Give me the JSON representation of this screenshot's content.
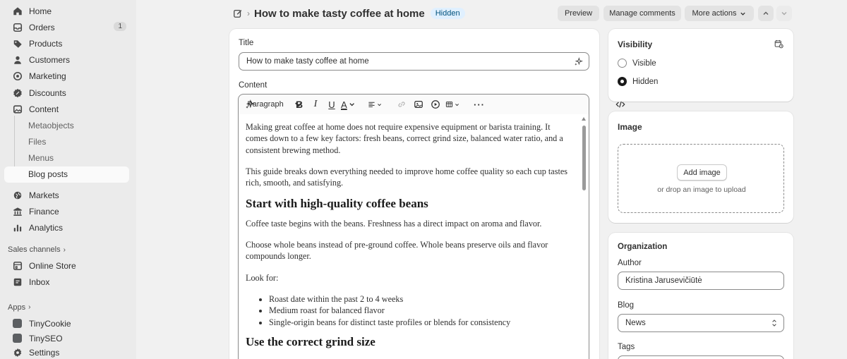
{
  "sidebar": {
    "main": [
      {
        "label": "Home",
        "icon": "home-icon"
      },
      {
        "label": "Orders",
        "icon": "inbox-icon",
        "badge": "1"
      },
      {
        "label": "Products",
        "icon": "tag-icon"
      },
      {
        "label": "Customers",
        "icon": "person-icon"
      },
      {
        "label": "Marketing",
        "icon": "target-icon"
      },
      {
        "label": "Discounts",
        "icon": "discount-icon"
      },
      {
        "label": "Content",
        "icon": "image-icon"
      }
    ],
    "content_sub": [
      "Metaobjects",
      "Files",
      "Menus",
      "Blog posts"
    ],
    "more": [
      {
        "label": "Markets",
        "icon": "globe-icon"
      },
      {
        "label": "Finance",
        "icon": "bank-icon"
      },
      {
        "label": "Analytics",
        "icon": "bar-chart-icon"
      }
    ],
    "sales_channels_label": "Sales channels",
    "sales_channels": [
      {
        "label": "Online Store",
        "icon": "store-icon"
      },
      {
        "label": "Inbox",
        "icon": "chat-icon"
      }
    ],
    "apps_label": "Apps",
    "apps": [
      {
        "label": "TinyCookie"
      },
      {
        "label": "TinySEO"
      }
    ],
    "settings_label": "Settings"
  },
  "header": {
    "title": "How to make tasty coffee at home",
    "status": "Hidden",
    "preview_label": "Preview",
    "manage_comments_label": "Manage comments",
    "more_actions_label": "More actions"
  },
  "editor": {
    "title_label": "Title",
    "title_value": "How to make tasty coffee at home",
    "content_label": "Content",
    "paragraph_style": "Paragraph",
    "body": {
      "p1": "Making great coffee at home does not require expensive equipment or barista training. It comes down to a few key factors: fresh beans, correct grind size, balanced water ratio, and a consistent brewing method.",
      "p2": "This guide breaks down everything needed to improve home coffee quality so each cup tastes rich, smooth, and satisfying.",
      "h1": "Start with high-quality coffee beans",
      "p3": "Coffee taste begins with the beans. Freshness has a direct impact on aroma and flavor.",
      "p4": "Choose whole beans instead of pre-ground coffee. Whole beans preserve oils and flavor compounds longer.",
      "p5": "Look for:",
      "list": [
        "Roast date within the past 2 to 4 weeks",
        "Medium roast for balanced flavor",
        "Single-origin beans for distinct taste profiles or blends for consistency"
      ],
      "h2": "Use the correct grind size"
    }
  },
  "visibility": {
    "title": "Visibility",
    "options": [
      "Visible",
      "Hidden"
    ],
    "selected": "Hidden"
  },
  "image_card": {
    "title": "Image",
    "add_label": "Add image",
    "hint": "or drop an image to upload"
  },
  "organization": {
    "title": "Organization",
    "author_label": "Author",
    "author_value": "Kristina Jarusevičiūtė",
    "blog_label": "Blog",
    "blog_value": "News",
    "tags_label": "Tags"
  }
}
